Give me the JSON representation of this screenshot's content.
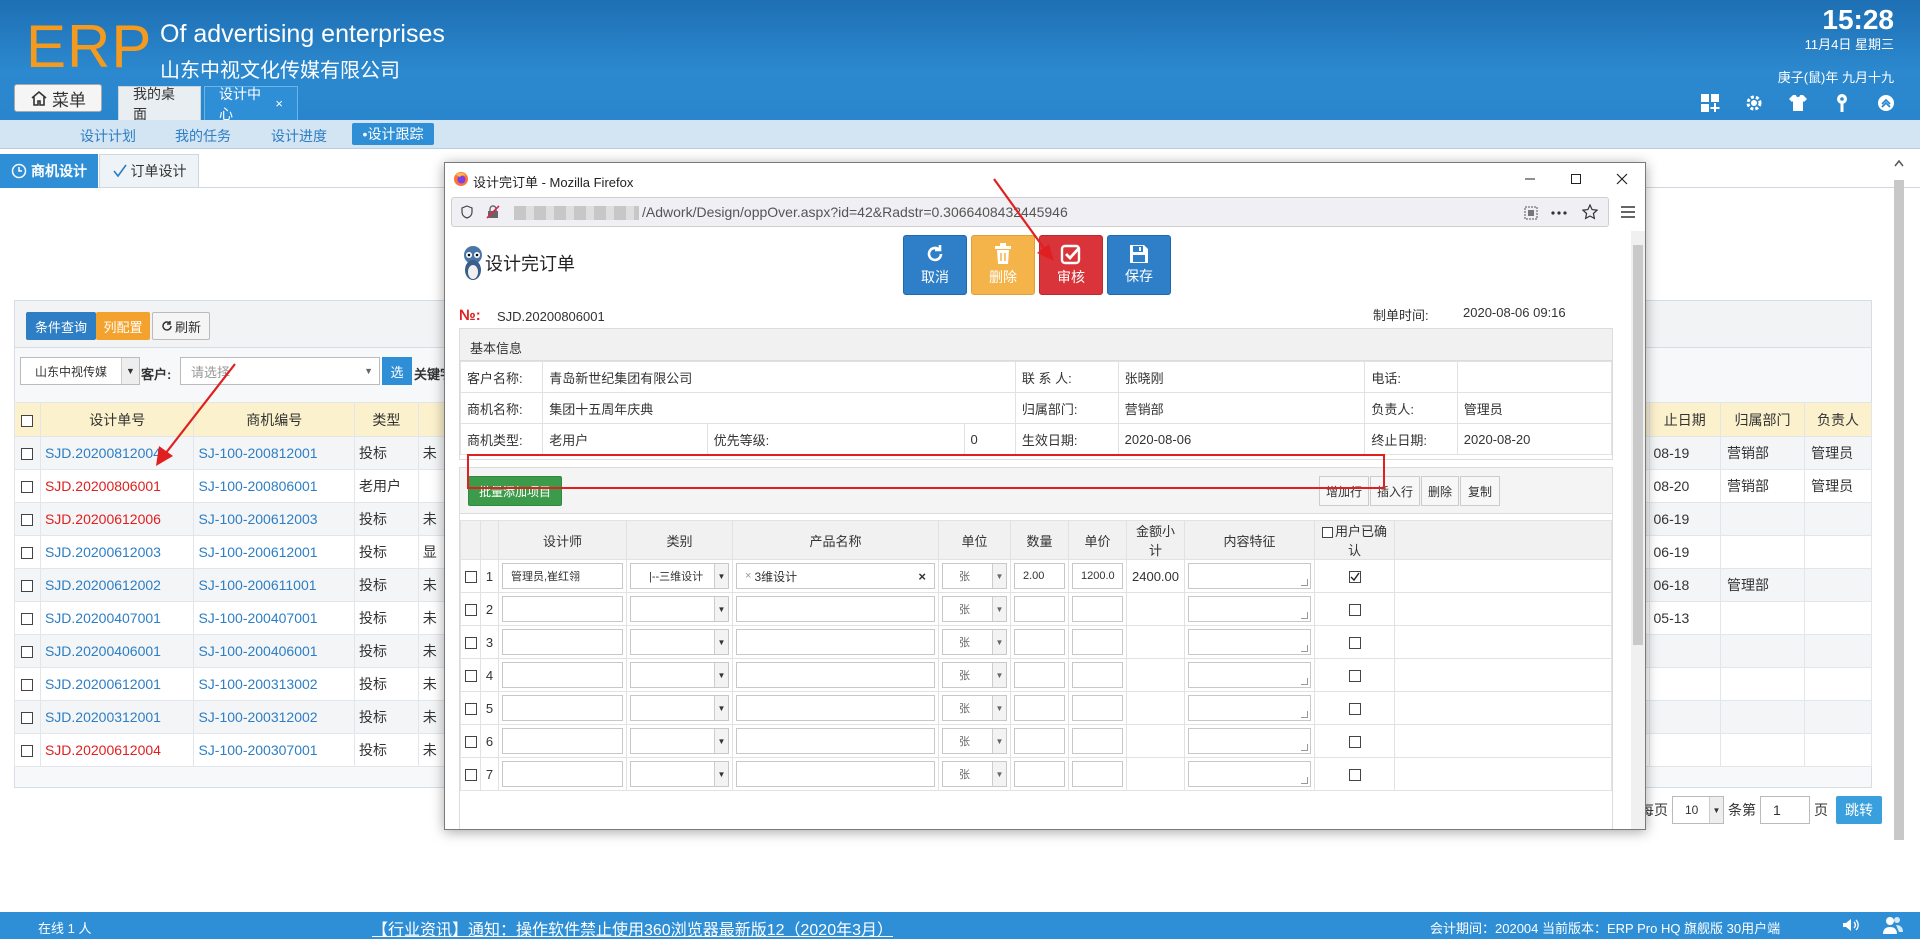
{
  "header": {
    "logo": "ERP",
    "company_en": "Of advertising enterprises",
    "company_cn": "山东中视文化传媒有限公司",
    "time": "15:28",
    "date": "11月4日 星期三",
    "lunar": "庚子(鼠)年 九月十九",
    "menu_label": "菜单",
    "tabs": [
      {
        "label": "我的桌面"
      },
      {
        "label": "设计中心",
        "close": "×"
      }
    ]
  },
  "subnav": [
    "设计计划",
    "我的任务",
    "设计进度",
    "•设计跟踪"
  ],
  "second_tabs": [
    "商机设计",
    "订单设计"
  ],
  "filter": {
    "query_btn": "条件查询",
    "cols_btn": "列配置",
    "refresh_btn": "刷新",
    "company": "山东中视传媒",
    "customer_label": "客户:",
    "customer_placeholder": "请选择",
    "select_btn": "选",
    "keyword_label": "关键字"
  },
  "left_table": {
    "headers": [
      "设计单号",
      "商机编号",
      "类型"
    ],
    "rows": [
      {
        "no": "SJD.20200812004",
        "biz": "SJ-100-200812001",
        "type": "投标",
        "cut": "未",
        "red": false
      },
      {
        "no": "SJD.20200806001",
        "biz": "SJ-100-200806001",
        "type": "老用户",
        "cut": "",
        "red": true
      },
      {
        "no": "SJD.20200612006",
        "biz": "SJ-100-200612003",
        "type": "投标",
        "cut": "未",
        "red": true
      },
      {
        "no": "SJD.20200612003",
        "biz": "SJ-100-200612001",
        "type": "投标",
        "cut": "显",
        "red": false
      },
      {
        "no": "SJD.20200612002",
        "biz": "SJ-100-200611001",
        "type": "投标",
        "cut": "未",
        "red": false
      },
      {
        "no": "SJD.20200407001",
        "biz": "SJ-100-200407001",
        "type": "投标",
        "cut": "未",
        "red": false
      },
      {
        "no": "SJD.20200406001",
        "biz": "SJ-100-200406001",
        "type": "投标",
        "cut": "未",
        "red": false
      },
      {
        "no": "SJD.20200612001",
        "biz": "SJ-100-200313002",
        "type": "投标",
        "cut": "未",
        "red": false
      },
      {
        "no": "SJD.20200312001",
        "biz": "SJ-100-200312002",
        "type": "投标",
        "cut": "未",
        "red": false
      },
      {
        "no": "SJD.20200612004",
        "biz": "SJ-100-200307001",
        "type": "投标",
        "cut": "未",
        "red": true
      }
    ]
  },
  "right_table": {
    "headers": [
      "止日期",
      "归属部门",
      "负责人"
    ],
    "rows": [
      [
        "08-19",
        "营销部",
        "管理员"
      ],
      [
        "08-20",
        "营销部",
        "管理员"
      ],
      [
        "06-19",
        "",
        ""
      ],
      [
        "06-19",
        "",
        ""
      ],
      [
        "06-18",
        "管理部",
        ""
      ],
      [
        "05-13",
        "",
        ""
      ],
      [
        "",
        "",
        ""
      ],
      [
        "",
        "",
        ""
      ],
      [
        "",
        "",
        ""
      ],
      [
        "",
        "",
        ""
      ]
    ]
  },
  "paging": {
    "per_page_label": "每页",
    "per_page": "10",
    "rows_label": "条第",
    "page": "1",
    "page_label": "页",
    "jump": "跳转"
  },
  "footer": {
    "online": "在线  1  人",
    "notice": "【行业资讯】通知：操作软件禁止使用360浏览器最新版12（2020年3月）",
    "version": "会计期间：202004 当前版本：ERP Pro HQ 旗舰版 30用户端"
  },
  "dialog": {
    "window_title": "设计完订单 - Mozilla Firefox",
    "url": "/Adwork/Design/oppOver.aspx?id=42&Radstr=0.3066408432445946",
    "doc_title": "设计完订单",
    "buttons": {
      "cancel": "取消",
      "delete": "删除",
      "approve": "审核",
      "save": "保存"
    },
    "no_label": "№:",
    "no_value": "SJD.20200806001",
    "made_label": "制单时间:",
    "made_value": "2020-08-06 09:16",
    "basic_header": "基本信息",
    "basic": {
      "customer_label": "客户名称:",
      "customer": "青岛新世纪集团有限公司",
      "contact_label": "联 系 人:",
      "contact": "张晓刚",
      "phone_label": "电话:",
      "phone": "",
      "biz_label": "商机名称:",
      "biz": "集团十五周年庆典",
      "dept_label": "归属部门:",
      "dept": "营销部",
      "owner_label": "负责人:",
      "owner": "管理员",
      "type_label": "商机类型:",
      "type": "老用户",
      "priority_label": "优先等级:",
      "priority": "0",
      "start_label": "生效日期:",
      "start": "2020-08-06",
      "end_label": "终止日期:",
      "end": "2020-08-20"
    },
    "batch_add": "批量添加项目",
    "row_buttons": [
      "增加行",
      "插入行",
      "删除",
      "复制"
    ],
    "grid_headers": [
      "设计师",
      "类别",
      "产品名称",
      "单位",
      "数量",
      "单价",
      "金额小计",
      "内容特征",
      "用户已确认"
    ],
    "grid_row1": {
      "designer": "管理员,崔红翎",
      "category": "|--三维设计",
      "product": "3维设计",
      "product_tag_x": "×",
      "product_clear": "×",
      "unit": "张",
      "qty": "2.00",
      "price": "1200.0",
      "subtotal": "2400.00"
    },
    "row_numbers": [
      "1",
      "2",
      "3",
      "4",
      "5",
      "6",
      "7"
    ],
    "unit_default": "张"
  }
}
